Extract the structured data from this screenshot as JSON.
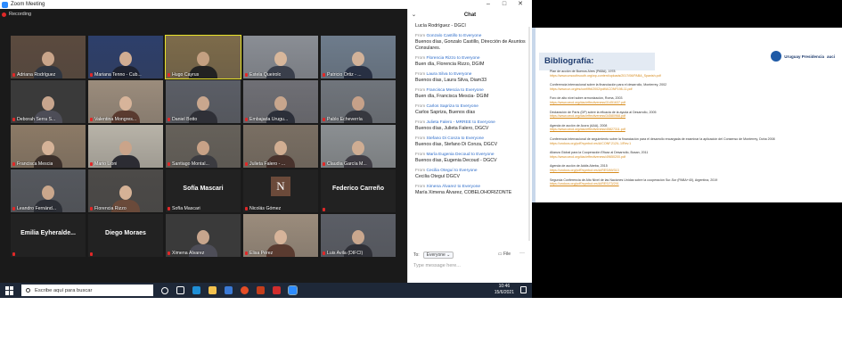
{
  "window": {
    "title": "Zoom Meeting",
    "recording_label": "Recording",
    "minimize": "–",
    "maximize": "□",
    "close": "✕"
  },
  "participants": [
    {
      "name": "Adriana Rodríguez"
    },
    {
      "name": "Mariana Tenno - Cub..."
    },
    {
      "name": "Hugo Cayrus",
      "active": true
    },
    {
      "name": "Estela Queirolo"
    },
    {
      "name": "Patricio Ortiz - ..."
    },
    {
      "name": "Deborah Serra S..."
    },
    {
      "name": "Valentina Mongres..."
    },
    {
      "name": "Daniel Botto"
    },
    {
      "name": "Embajada Urugu..."
    },
    {
      "name": "Pablo Echeverría"
    },
    {
      "name": "Francisca Mescia"
    },
    {
      "name": "Mario Lioni"
    },
    {
      "name": "Santiago Montal..."
    },
    {
      "name": "Julieta Falero - ..."
    },
    {
      "name": "Claudia García M..."
    },
    {
      "name": "Leandro Fernánd..."
    },
    {
      "name": "Florencia Rizzo"
    },
    {
      "name": "Sofía Mascari",
      "big": "Sofía Mascari"
    },
    {
      "name": "Nicolás Gómez",
      "letter": "N"
    },
    {
      "name": "",
      "big": "Federico Carreño"
    },
    {
      "name": "",
      "big": "Emilia  Eyheralde..."
    },
    {
      "name": "",
      "big": "Diego Moraes"
    },
    {
      "name": "Ximena Álvarez"
    },
    {
      "name": "Elisa Pérez"
    },
    {
      "name": "Luis Avila (DIFCI)"
    }
  ],
  "chat": {
    "title": "Chat",
    "top_line": "Lucía Rodríguez - DGCI",
    "from_word": "From",
    "to_word": "to Everyone",
    "messages": [
      {
        "who": "Gonzalo Castillo",
        "text": "Buenos días, Gonzalo Castillo, Dirección de Asuntos Consulares."
      },
      {
        "who": "Florencia Rizzo",
        "text": "Buen día, Florencia Rizzo, DGIM"
      },
      {
        "who": "Laura Silva",
        "text": "Buenos días, Laura Silva, Diam33"
      },
      {
        "who": "Francisca Mescia",
        "text": "Buen día, Francisca Mescia- DGIM"
      },
      {
        "who": "Carlos Sapriza",
        "text": "Carlos Sapriza, Buenos días"
      },
      {
        "who": "Julieta Falero - MRREE",
        "text": "Buenos días, Julieta Falero, DGCV"
      },
      {
        "who": "Stefano Di Conza",
        "text": "Buenos días, Stefano Di Conza, DGCV"
      },
      {
        "who": "María Eugenia Decoud",
        "text": "Buenos días, Eugenia Decoud - DGCV"
      },
      {
        "who": "Cecilia Oteguí",
        "text": "Cecilia Oteguí DGCV"
      },
      {
        "who": "Ximena Álvarez",
        "text": "María Ximena Álvarez, COBELOHORIZONTE"
      }
    ],
    "to_label": "To:",
    "to_value": "Everyone",
    "file_label": "File",
    "more": "···",
    "placeholder": "Type message here..."
  },
  "taskbar": {
    "search_placeholder": "Escribe aquí para buscar",
    "time": "10:46",
    "date": "15/6/2021"
  },
  "slide": {
    "title": "Bibliografía:",
    "logo_text": "Uruguay Presidencia",
    "logo_tag": "auci",
    "entries": [
      {
        "t": "Plan de acción de Buenos Aires (PABA), 1978",
        "u": "https://www.unsouthsouth.org/wp-content/uploads/2017/06/PABA_Spanish.pdf"
      },
      {
        "t": "Conferencia internacional sobre la financiación para el desarrollo, Monterrey, 2002",
        "u": "https://www.un.org/es/conf/ffd/2002/pdf/ACONF198-11.pdf"
      },
      {
        "t": "Foro de alto nivel sobre armonización, Roma, 2003",
        "u": "https://www.oecd.org/dac/effectiveness/31451637.pdf"
      },
      {
        "t": "Declaración de París (DP) sobre la eficacia de la ayuda al Desarrollo, 2005",
        "u": "https://www.oecd.org/dac/effectiveness/34580968.pdf"
      },
      {
        "t": "Agenda de acción de Accra (AAA), 2008",
        "u": "https://www.oecd.org/dac/effectiveness/45827311.pdf"
      },
      {
        "t": "Conferencia internacional de seguimiento sobre la financiación para el desarrollo encargada de examinar la aplicación del Consenso de Monterrey, Doha 2008",
        "u": "https://undocs.org/pdf?symbol=es/A/CONF.212/L.1/Rev.1"
      },
      {
        "t": "Alianza Global para la Cooperación Eficaz al Desarrollo, Busan, 2011",
        "u": "https://www.oecd.org/dac/effectiveness/49650200.pdf"
      },
      {
        "t": "Agenda de acción de Addis Abeba, 2015",
        "u": "https://undocs.org/pdf?symbol=es/A/RES/69/313"
      },
      {
        "t": "Segunda Conferencia de Alto Nivel de las Naciones Unidas sobre la cooperación Sur-Sur (PABA+40), Argentina, 2019",
        "u": "https://undocs.org/pdf?symbol=es/A/RES/73/291"
      }
    ]
  }
}
